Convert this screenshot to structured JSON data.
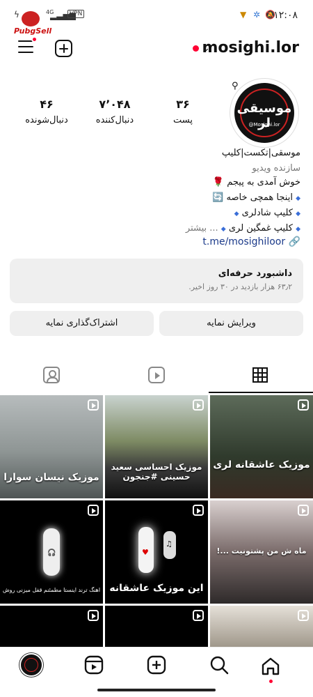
{
  "status_bar": {
    "time": "۱۲:۰۸",
    "network": "4G",
    "vpn": "VPN"
  },
  "brand_overlay": "PubgSell",
  "header": {
    "username": "mosighi.lor"
  },
  "stats": [
    {
      "value": "۳۶",
      "label": "پست"
    },
    {
      "value": "۷٬۰۴۸",
      "label": "دنبال‌کننده"
    },
    {
      "value": "۴۶",
      "label": "دنبال‌شونده"
    }
  ],
  "avatar": {
    "title": "موسیقی لر",
    "handle": "@Mosighi.lor"
  },
  "bio": {
    "name": "موسقی|تکست|کلیپ",
    "category": "سازنده ویدیو",
    "line1": "خوش آمدی به پیجم 🌹",
    "line2": "اینجا همچی خاصه 🔄",
    "line3": "کلیپ شادلری",
    "line4": "کلیپ غمگین لری",
    "more": "... بیشتر",
    "link": "t.me/mosighiloor"
  },
  "dashboard": {
    "title": "داشبورد حرفه‌ای",
    "subtitle": "۶۳٫۲ هزار بازدید در ۳۰ روز اخیر."
  },
  "buttons": {
    "edit": "ویرایش نمایه",
    "share": "اشتراک‌گذاری نمایه"
  },
  "posts": [
    {
      "caption": "موزیک عاشقانه لری"
    },
    {
      "caption": "موزیک احساسی سعید حسینی #جنجون"
    },
    {
      "caption": "موزیک نیسان سوارا"
    },
    {
      "caption": "ماه ش من پشتونیت ...!"
    },
    {
      "caption": "این موزیک عاشقانه"
    },
    {
      "caption": "اهنگ ترند اینستا مطمئنم قفل میزنی روش"
    }
  ],
  "colors": {
    "accent": "#ff0033",
    "link": "#1b3a8a"
  }
}
